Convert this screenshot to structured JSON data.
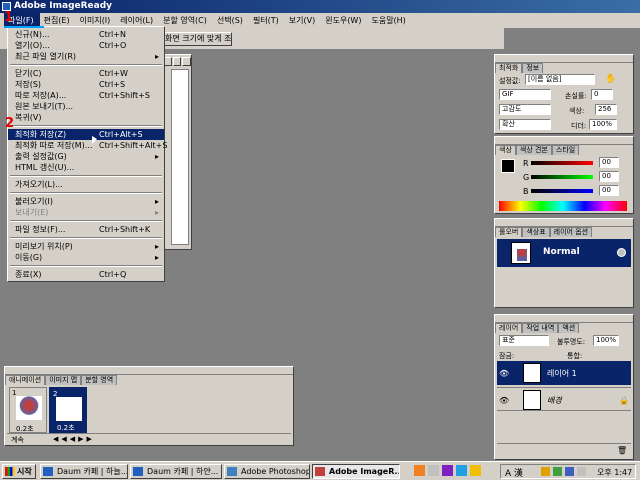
{
  "window": {
    "title": "Adobe ImageReady"
  },
  "menubar": [
    {
      "label": "파일(F)"
    },
    {
      "label": "편집(E)"
    },
    {
      "label": "이미지(I)"
    },
    {
      "label": "레이어(L)"
    },
    {
      "label": "분할 영역(C)"
    },
    {
      "label": "선택(S)"
    },
    {
      "label": "필터(T)"
    },
    {
      "label": "보기(V)"
    },
    {
      "label": "윈도우(W)"
    },
    {
      "label": "도움말(H)"
    }
  ],
  "options_bar": {
    "fit_button": "화면 크기에 맞게 조정"
  },
  "file_menu": [
    {
      "label": "신규(N)...",
      "shortcut": "Ctrl+N"
    },
    {
      "label": "열기(O)...",
      "shortcut": "Ctrl+O"
    },
    {
      "label": "최근 파일 열기(R)",
      "shortcut": "",
      "arrow": "▸"
    },
    {
      "label": "닫기(C)",
      "shortcut": "Ctrl+W"
    },
    {
      "label": "저장(S)",
      "shortcut": "Ctrl+S"
    },
    {
      "label": "따로 저장(A)...",
      "shortcut": "Ctrl+Shift+S"
    },
    {
      "label": "원본 보내기(T)...",
      "shortcut": ""
    },
    {
      "label": "복귀(V)",
      "shortcut": ""
    },
    {
      "label": "최적화 저장(Z)",
      "shortcut": "Ctrl+Alt+S"
    },
    {
      "label": "최적화 따로 저장(M)...",
      "shortcut": "Ctrl+Shift+Alt+S"
    },
    {
      "label": "출력 설정값(G)",
      "shortcut": "",
      "arrow": "▸"
    },
    {
      "label": "HTML 갱신(U)...",
      "shortcut": ""
    },
    {
      "label": "가져오기(L)...",
      "shortcut": ""
    },
    {
      "label": "불러오기(I)",
      "shortcut": "",
      "arrow": "▸"
    },
    {
      "label": "보내기(E)",
      "shortcut": "",
      "arrow": "▸"
    },
    {
      "label": "파일 정보(F)...",
      "shortcut": "Ctrl+Shift+K"
    },
    {
      "label": "미리보기 위치(P)",
      "shortcut": "",
      "arrow": "▸"
    },
    {
      "label": "이동(G)",
      "shortcut": "",
      "arrow": "▸"
    },
    {
      "label": "종료(X)",
      "shortcut": "Ctrl+Q"
    }
  ],
  "annotations": {
    "step1": "1",
    "step2": "2"
  },
  "optimize_panel": {
    "tabs": [
      "최적화",
      "정보"
    ],
    "preset_label": "설정값:",
    "preset_value": "[이름 없음]",
    "format": "GIF",
    "lossy_label": "손실률:",
    "lossy_value": "0",
    "palette": "고감도",
    "colors_label": "색상:",
    "colors_value": "256",
    "dither": "확산",
    "dither_label": "디더:",
    "dither_value": "100%"
  },
  "color_panel": {
    "tabs": [
      "색상",
      "색상 견본",
      "스타일"
    ],
    "r_label": "R",
    "r_value": "00",
    "g_label": "G",
    "g_value": "00",
    "b_label": "B",
    "b_value": "00"
  },
  "rollover_panel": {
    "tabs": [
      "롤오버",
      "색상표",
      "레이어 옵션"
    ],
    "state": "Normal"
  },
  "layers_panel": {
    "tabs": [
      "레이어",
      "작업 내역",
      "액션"
    ],
    "blend": "표준",
    "opacity_label": "불투명도:",
    "opacity_value": "100%",
    "lock_label": "잠금:",
    "unify_label": "통합:",
    "layers": [
      {
        "name": "레이어 1"
      },
      {
        "name": "배경"
      }
    ]
  },
  "animation_panel": {
    "tabs": [
      "애니메이션",
      "이미지 맵",
      "분할 영역"
    ],
    "frames": [
      {
        "num": "1",
        "delay": "0.2초"
      },
      {
        "num": "2",
        "delay": "0.2초"
      }
    ],
    "loop": "계속"
  },
  "taskbar": {
    "start": "시작",
    "items": [
      {
        "label": "Daum 카페 | 하늘..."
      },
      {
        "label": "Daum 카페 | 하얀..."
      },
      {
        "label": "Adobe Photoshop"
      },
      {
        "label": "Adobe ImageR..."
      }
    ],
    "clock": "오후 1:47",
    "ime": "A 漢"
  },
  "colors": {
    "navy": "#0a246a",
    "face": "#d4d0c8",
    "workspace": "#808080",
    "annotation": "#e00000"
  }
}
